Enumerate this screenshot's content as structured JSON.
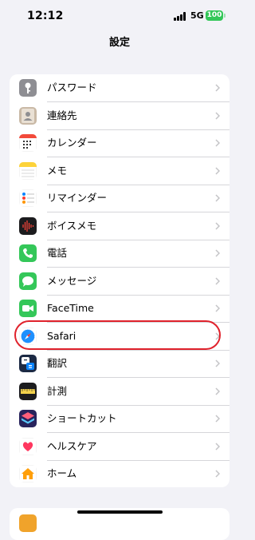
{
  "status": {
    "time": "12:12",
    "network": "5G",
    "battery": "100"
  },
  "nav": {
    "title": "設定"
  },
  "items": [
    {
      "label": "パスワード",
      "icon": "key-icon"
    },
    {
      "label": "連絡先",
      "icon": "contacts-icon"
    },
    {
      "label": "カレンダー",
      "icon": "calendar-icon"
    },
    {
      "label": "メモ",
      "icon": "notes-icon"
    },
    {
      "label": "リマインダー",
      "icon": "reminders-icon"
    },
    {
      "label": "ボイスメモ",
      "icon": "voice-memos-icon"
    },
    {
      "label": "電話",
      "icon": "phone-icon"
    },
    {
      "label": "メッセージ",
      "icon": "messages-icon"
    },
    {
      "label": "FaceTime",
      "icon": "facetime-icon"
    },
    {
      "label": "Safari",
      "icon": "safari-icon"
    },
    {
      "label": "翻訳",
      "icon": "translate-icon"
    },
    {
      "label": "計測",
      "icon": "measure-icon"
    },
    {
      "label": "ショートカット",
      "icon": "shortcuts-icon"
    },
    {
      "label": "ヘルスケア",
      "icon": "health-icon"
    },
    {
      "label": "ホーム",
      "icon": "home-icon"
    }
  ],
  "highlight_color": "#e0222c"
}
